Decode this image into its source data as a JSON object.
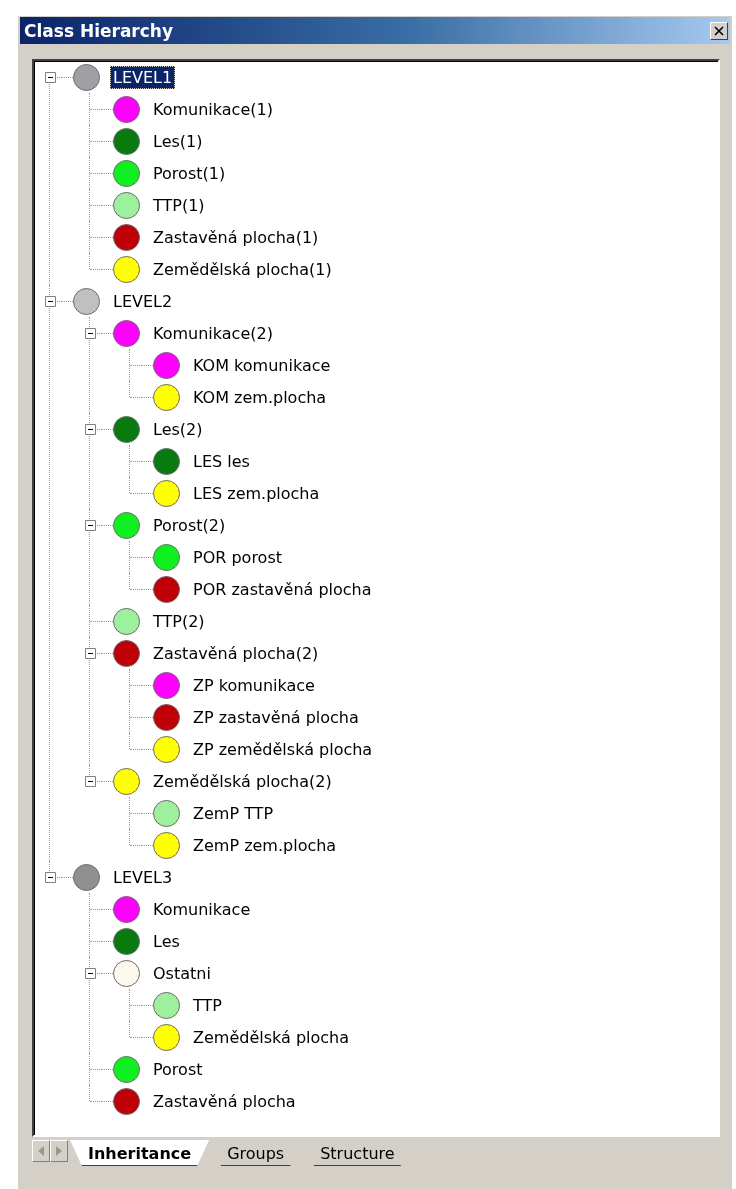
{
  "window": {
    "title": "Class Hierarchy"
  },
  "tree": [
    {
      "label": "LEVEL1",
      "color": "#a0a0a4",
      "expanded": true,
      "selected": true,
      "children": [
        {
          "label": "Komunikace(1)",
          "color": "#ff00ff",
          "selected": false
        },
        {
          "label": "Les(1)",
          "color": "#087a10",
          "selected": false
        },
        {
          "label": "Porost(1)",
          "color": "#10f020",
          "selected": false
        },
        {
          "label": "TTP(1)",
          "color": "#9ef09e",
          "selected": false
        },
        {
          "label": "Zastavěná plocha(1)",
          "color": "#c00008",
          "selected": false
        },
        {
          "label": "Zemědělská plocha(1)",
          "color": "#ffff00",
          "selected": false
        }
      ]
    },
    {
      "label": "LEVEL2",
      "color": "#c0c0c0",
      "expanded": true,
      "selected": false,
      "children": [
        {
          "label": "Komunikace(2)",
          "color": "#ff00ff",
          "expanded": true,
          "selected": false,
          "children": [
            {
              "label": "KOM komunikace",
              "color": "#ff00ff",
              "selected": false
            },
            {
              "label": "KOM zem.plocha",
              "color": "#ffff00",
              "selected": false
            }
          ]
        },
        {
          "label": "Les(2)",
          "color": "#087a10",
          "expanded": true,
          "selected": false,
          "children": [
            {
              "label": "LES les",
              "color": "#087a10",
              "selected": false
            },
            {
              "label": "LES zem.plocha",
              "color": "#ffff00",
              "selected": false
            }
          ]
        },
        {
          "label": "Porost(2)",
          "color": "#10f020",
          "expanded": true,
          "selected": false,
          "children": [
            {
              "label": "POR porost",
              "color": "#10f020",
              "selected": false
            },
            {
              "label": "POR zastavěná plocha",
              "color": "#c00008",
              "selected": false
            }
          ]
        },
        {
          "label": "TTP(2)",
          "color": "#9ef09e",
          "selected": false
        },
        {
          "label": "Zastavěná plocha(2)",
          "color": "#c00008",
          "expanded": true,
          "selected": false,
          "children": [
            {
              "label": "ZP komunikace",
              "color": "#ff00ff",
              "selected": false
            },
            {
              "label": "ZP zastavěná plocha",
              "color": "#c00008",
              "selected": false
            },
            {
              "label": "ZP zemědělská plocha",
              "color": "#ffff00",
              "selected": false
            }
          ]
        },
        {
          "label": "Zemědělská plocha(2)",
          "color": "#ffff00",
          "expanded": true,
          "selected": false,
          "children": [
            {
              "label": "ZemP TTP",
              "color": "#9ef09e",
              "selected": false
            },
            {
              "label": "ZemP zem.plocha",
              "color": "#ffff00",
              "selected": false
            }
          ]
        }
      ]
    },
    {
      "label": "LEVEL3",
      "color": "#909090",
      "expanded": true,
      "selected": false,
      "children": [
        {
          "label": "Komunikace",
          "color": "#ff00ff",
          "selected": false
        },
        {
          "label": "Les",
          "color": "#087a10",
          "selected": false
        },
        {
          "label": "Ostatni",
          "color": "#fdf8ee",
          "expanded": true,
          "selected": false,
          "children": [
            {
              "label": "TTP",
              "color": "#9ef09e",
              "selected": false
            },
            {
              "label": "Zemědělská plocha",
              "color": "#ffff00",
              "selected": false
            }
          ]
        },
        {
          "label": "Porost",
          "color": "#10f020",
          "selected": false
        },
        {
          "label": "Zastavěná plocha",
          "color": "#c00008",
          "selected": false
        }
      ]
    }
  ],
  "tabs": [
    {
      "label": "Inheritance",
      "selected": true
    },
    {
      "label": "Groups",
      "selected": false
    },
    {
      "label": "Structure",
      "selected": false
    }
  ]
}
